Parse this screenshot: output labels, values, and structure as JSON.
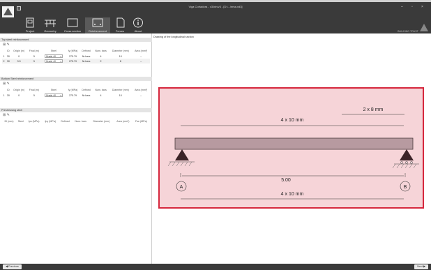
{
  "window": {
    "title": "Viga Cortadora - v3.bin/v3 - [D:\\...\\ema.vd3]",
    "controls": [
      "–",
      "▫",
      "×"
    ]
  },
  "toolbar": {
    "tools": [
      {
        "label": "Project",
        "icon": "document-icon"
      },
      {
        "label": "Geometry",
        "icon": "beam-geometry-icon"
      },
      {
        "label": "Cross section",
        "icon": "cross-section-icon"
      },
      {
        "label": "Reinforcement",
        "icon": "reinforcement-icon"
      },
      {
        "label": "Forces",
        "icon": "forces-icon"
      },
      {
        "label": "About",
        "icon": "info-icon"
      }
    ],
    "active": "Reinforcement",
    "brand": "BUILDING TRUST"
  },
  "top_steel": {
    "header": "Top steel reinforcement",
    "columns": [
      "ID",
      "Origin (m)",
      "Final (m)",
      "Steel",
      "fy (MPa)",
      "Defined",
      "Num. bars",
      "Diameter (mm)",
      "Area (mm²)"
    ],
    "rows": [
      {
        "id": "1",
        "c1": "30",
        "origin": "0",
        "final": "5",
        "steel": "Grade 40",
        "fy": "275.79",
        "defined": "Nr.bars",
        "num": "4",
        "diam": "10",
        "area": "–"
      },
      {
        "id": "2",
        "c1": "30",
        "origin": "3.5",
        "final": "5",
        "steel": "Grade 40",
        "fy": "275.79",
        "defined": "Nr.bars",
        "num": "2",
        "diam": "8",
        "area": "–"
      }
    ]
  },
  "bottom_steel": {
    "header": "Bottom Steel reinforcement",
    "columns": [
      "ID",
      "Origin (m)",
      "Final (m)",
      "Steel",
      "fy (MPa)",
      "Defined",
      "Num. bars",
      "Diameter (mm)",
      "Area (mm²)"
    ],
    "rows": [
      {
        "id": "1",
        "c1": "30",
        "origin": "0",
        "final": "5",
        "steel": "Grade 40",
        "fy": "275.79",
        "defined": "Nr.bars",
        "num": "4",
        "diam": "10",
        "area": "–"
      }
    ]
  },
  "prestress": {
    "header": "Prestressing steel",
    "columns": [
      "ID (mm)",
      "Steel",
      "fpu (MPa)",
      "fpy (MPa)",
      "Defined",
      "Num. bars",
      "Diameter (mm)",
      "Area (mm²)",
      "Fse (MPa)"
    ]
  },
  "drawing": {
    "title": "Drawing of the longitudinal section",
    "top_label_short": "2 x 8 mm",
    "top_label_long": "4 x 10 mm",
    "span": "5.00",
    "support_a": "A",
    "support_b": "B",
    "bottom_label": "4 x 10 mm"
  },
  "nav": {
    "previous": "Previous",
    "next": "Next"
  }
}
